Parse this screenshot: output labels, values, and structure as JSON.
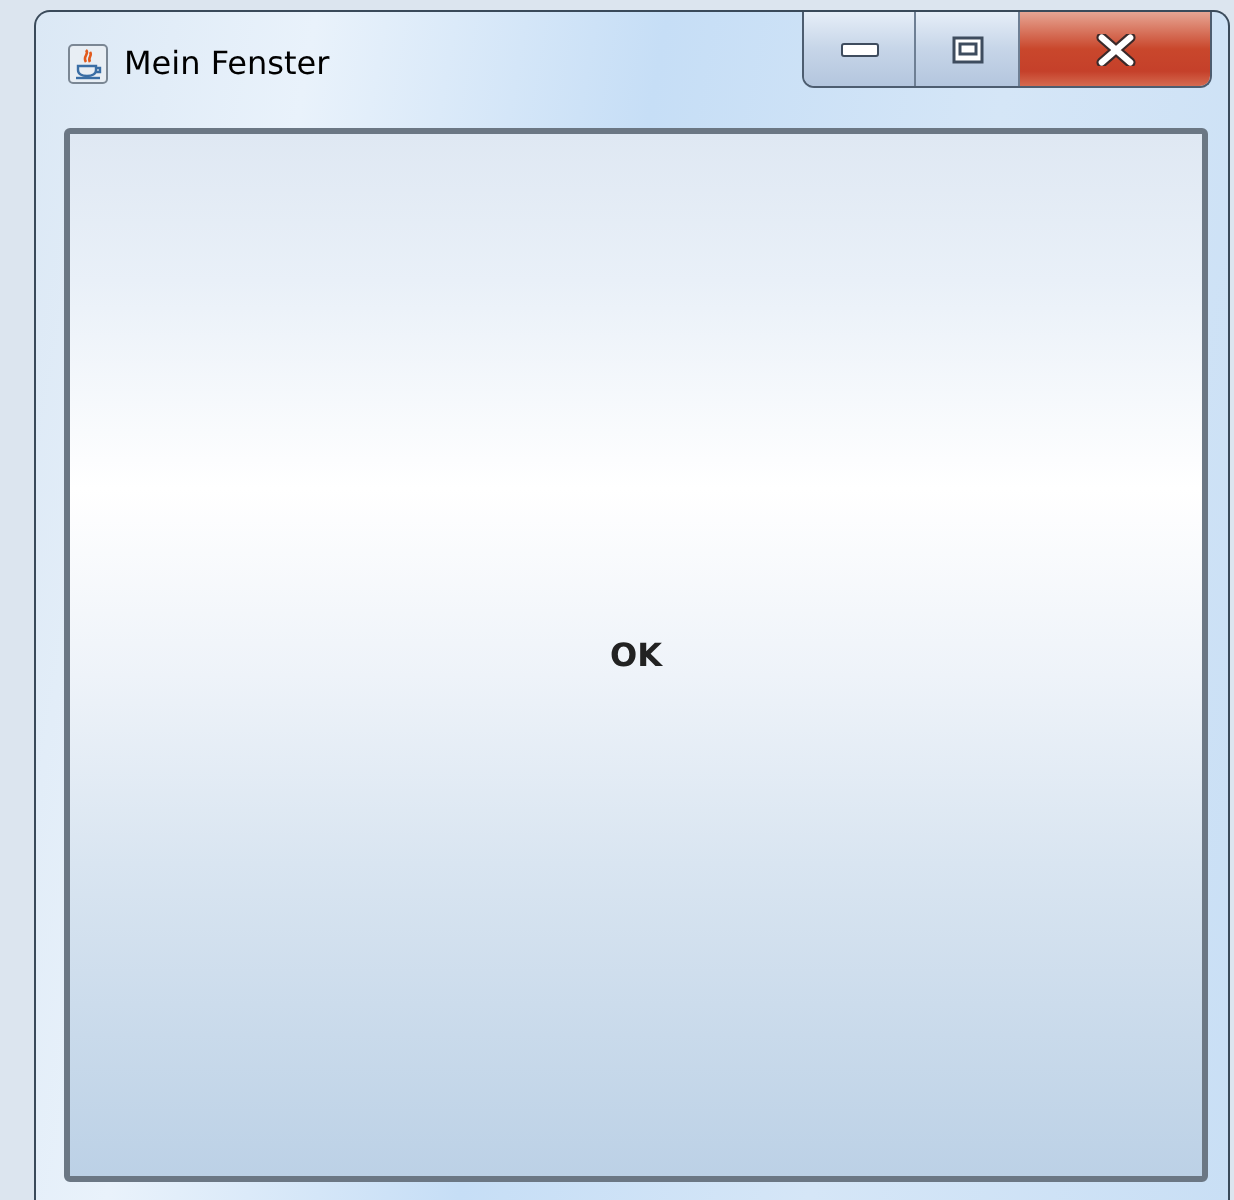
{
  "window": {
    "title": "Mein Fenster"
  },
  "button": {
    "label": "OK"
  }
}
